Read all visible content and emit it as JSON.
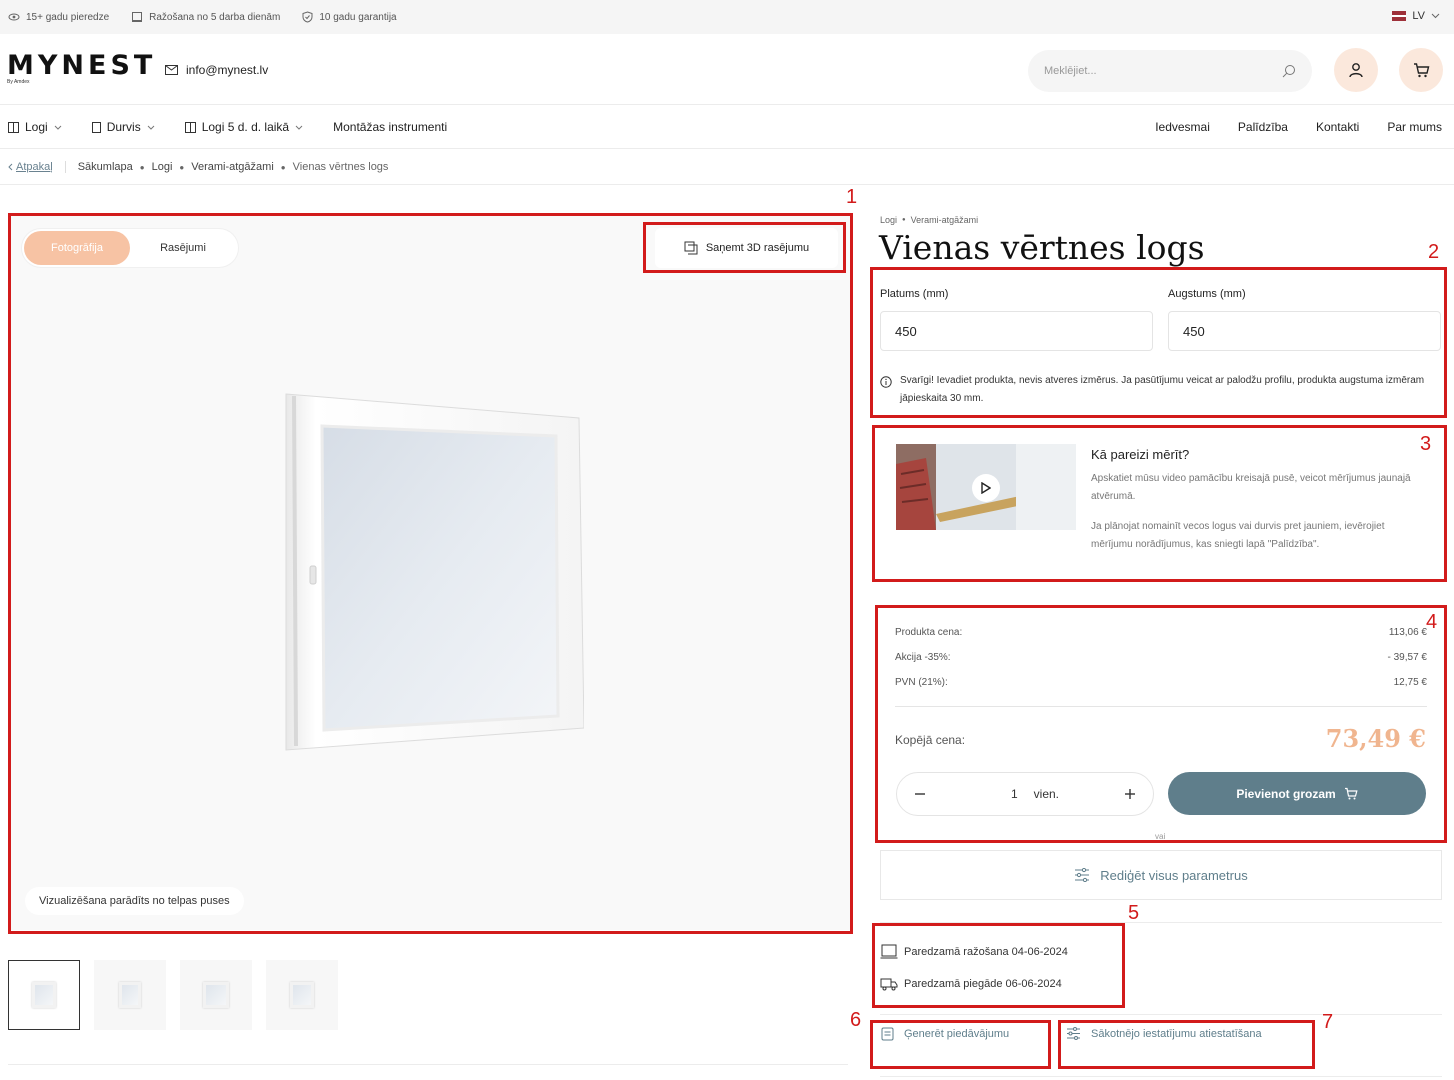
{
  "topbar": {
    "features": [
      "15+ gadu pieredze",
      "Ražošana no 5 darba dienām",
      "10 gadu garantija"
    ],
    "language": "LV"
  },
  "header": {
    "logo": "MYNEST",
    "logo_sub": "By Amdex",
    "email": "info@mynest.lv",
    "search_placeholder": "Meklējiet..."
  },
  "nav": {
    "left": [
      "Logi",
      "Durvis",
      "Logi 5 d. d. laikā",
      "Montāžas instrumenti"
    ],
    "right": [
      "Iedvesmai",
      "Palīdzība",
      "Kontakti",
      "Par mums"
    ]
  },
  "breadcrumb": {
    "back": "Atpakaļ",
    "items": [
      "Sākumlapa",
      "Logi",
      "Verami-atgāžami",
      "Vienas vērtnes logs"
    ]
  },
  "gallery": {
    "tabs": [
      "Fotogrāfija",
      "Rasējumi"
    ],
    "btn_3d": "Saņemt 3D rasējumu",
    "viz_note": "Vizualizēšana parādīts no telpas puses"
  },
  "product": {
    "category_crumbs": [
      "Logi",
      "Verami-atgāžami"
    ],
    "title": "Vienas vērtnes logs",
    "width_label": "Platums (mm)",
    "width_value": "450",
    "height_label": "Augstums (mm)",
    "height_value": "450",
    "note": "Svarīgi! Ievadiet produkta, nevis atveres izmērus. Ja pasūtījumu veicat ar palodžu profilu, produkta augstuma izmēram jāpieskaita 30 mm."
  },
  "video": {
    "title": "Kā pareizi mērīt?",
    "text1": "Apskatiet mūsu video pamācību kreisajā pusē, veicot mērījumus jaunajā atvērumā.",
    "text2": "Ja plānojat nomainīt vecos logus vai durvis pret jauniem, ievērojiet mērījumu norādījumus, kas sniegti lapā \"Palīdzība\"."
  },
  "price": {
    "rows": [
      {
        "label": "Produkta cena:",
        "value": "113,06 €"
      },
      {
        "label": "Akcija -35%:",
        "value": "- 39,57 €"
      },
      {
        "label": "PVN (21%):",
        "value": "12,75 €"
      }
    ],
    "total_label": "Kopējā cena:",
    "total_value": "73,49 €",
    "qty": "1",
    "unit": "vien.",
    "add_to_cart": "Pievienot grozam",
    "or": "vai",
    "edit_all": "Rediģēt visus parametrus"
  },
  "delivery": {
    "production": "Paredzamā ražošana 04-06-2024",
    "shipping": "Paredzamā piegāde 06-06-2024"
  },
  "actions": {
    "generate_offer": "Ģenerēt piedāvājumu",
    "reset": "Sākotnējo iestatījumu atiestatīšana"
  },
  "annotations": [
    "1",
    "2",
    "3",
    "4",
    "5",
    "6",
    "7"
  ],
  "colors": {
    "accent_peach": "#f7c3a4",
    "primary_slate": "#5f7e8b",
    "annotation_red": "#d21b1b",
    "price_total": "#f0b58f"
  }
}
